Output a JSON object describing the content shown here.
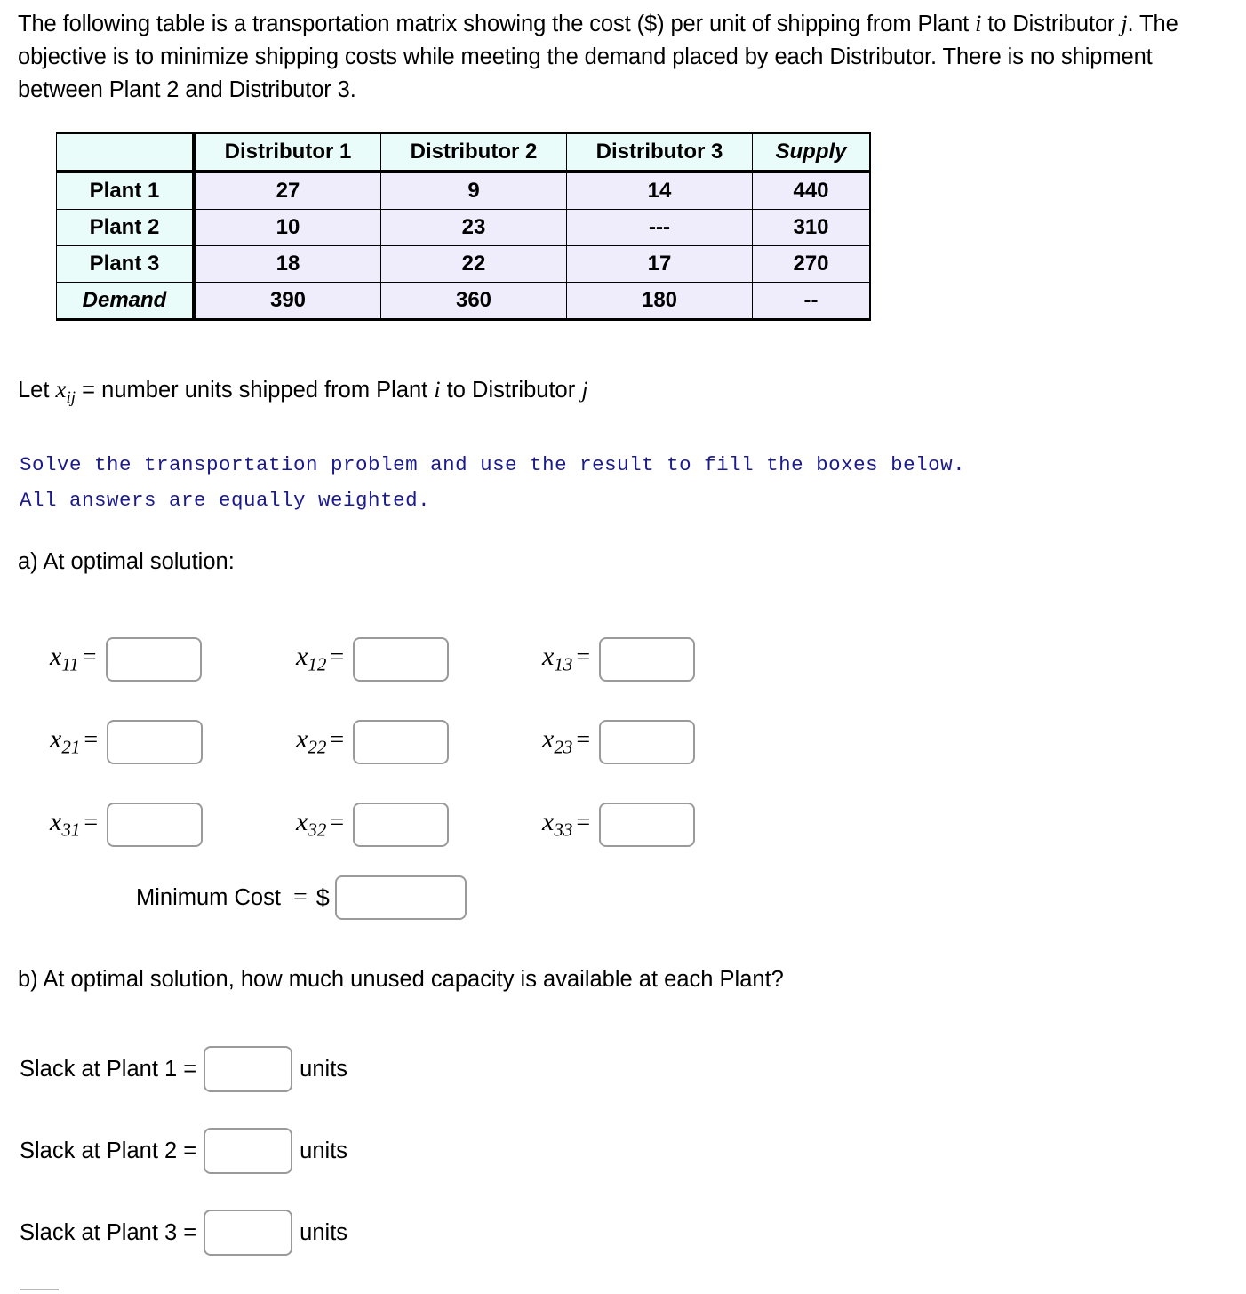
{
  "intro": {
    "line1_a": "The following table is a transportation matrix showing the cost ($) per unit of shipping from Plant ",
    "var_i": "i",
    "line1_b": " to",
    "line2_a": "Distributor ",
    "var_j": "j",
    "line2_b": ". The objective is to minimize shipping costs while meeting the demand placed by each",
    "line3": "Distributor. There is no shipment between Plant 2 and Distributor 3."
  },
  "table": {
    "corner_label": "",
    "column_headers": [
      "Distributor 1",
      "Distributor 2",
      "Distributor 3",
      "Supply"
    ],
    "rows": [
      {
        "label": "Plant 1",
        "cells": [
          "27",
          "9",
          "14",
          "440"
        ]
      },
      {
        "label": "Plant 2",
        "cells": [
          "10",
          "23",
          "---",
          "310"
        ]
      },
      {
        "label": "Plant 3",
        "cells": [
          "18",
          "22",
          "17",
          "270"
        ]
      },
      {
        "label": "Demand",
        "cells": [
          "390",
          "360",
          "180",
          "--"
        ]
      }
    ],
    "colors": {
      "header_bg": "#eafcfa",
      "data_bg": "#efecfb",
      "border": "#000000"
    }
  },
  "definition": {
    "prefix": "Let ",
    "var": "x",
    "var_sub": "ij",
    "suffix_a": " = number units shipped from Plant ",
    "var_i": "i",
    "suffix_b": " to Distributor ",
    "var_j": "j"
  },
  "instruction": {
    "line1": "Solve the transportation problem and use the result to fill the boxes below.",
    "line2": "All answers are equally weighted.",
    "color": "#1a1a8c"
  },
  "part_a": {
    "heading": "a) At optimal solution:",
    "variables": [
      [
        {
          "name": "x",
          "sub": "11",
          "eq": "=",
          "value": "",
          "placeholder": ""
        },
        {
          "name": "x",
          "sub": "12",
          "eq": "=",
          "value": "",
          "placeholder": ""
        },
        {
          "name": "x",
          "sub": "13",
          "eq": "=",
          "value": "",
          "placeholder": ""
        }
      ],
      [
        {
          "name": "x",
          "sub": "21",
          "eq": "=",
          "value": "",
          "placeholder": ""
        },
        {
          "name": "x",
          "sub": "22",
          "eq": "=",
          "value": "",
          "placeholder": ""
        },
        {
          "name": "x",
          "sub": "23",
          "eq": "=",
          "value": "",
          "placeholder": ""
        }
      ],
      [
        {
          "name": "x",
          "sub": "31",
          "eq": "=",
          "value": "",
          "placeholder": ""
        },
        {
          "name": "x",
          "sub": "32",
          "eq": "=",
          "value": "",
          "placeholder": ""
        },
        {
          "name": "x",
          "sub": "33",
          "eq": "=",
          "value": "",
          "placeholder": ""
        }
      ]
    ],
    "minimum_cost": {
      "label": "Minimum Cost",
      "eq": "=",
      "currency": "$",
      "value": "",
      "placeholder": ""
    }
  },
  "part_b": {
    "heading": "b) At optimal solution, how much unused capacity is available at each Plant?",
    "slacks": [
      {
        "label": "Slack at Plant 1 =",
        "value": "",
        "placeholder": "",
        "units": "units"
      },
      {
        "label": "Slack at Plant 2 =",
        "value": "",
        "placeholder": "",
        "units": "units"
      },
      {
        "label": "Slack at Plant 3 =",
        "value": "",
        "placeholder": "",
        "units": "units"
      }
    ]
  }
}
